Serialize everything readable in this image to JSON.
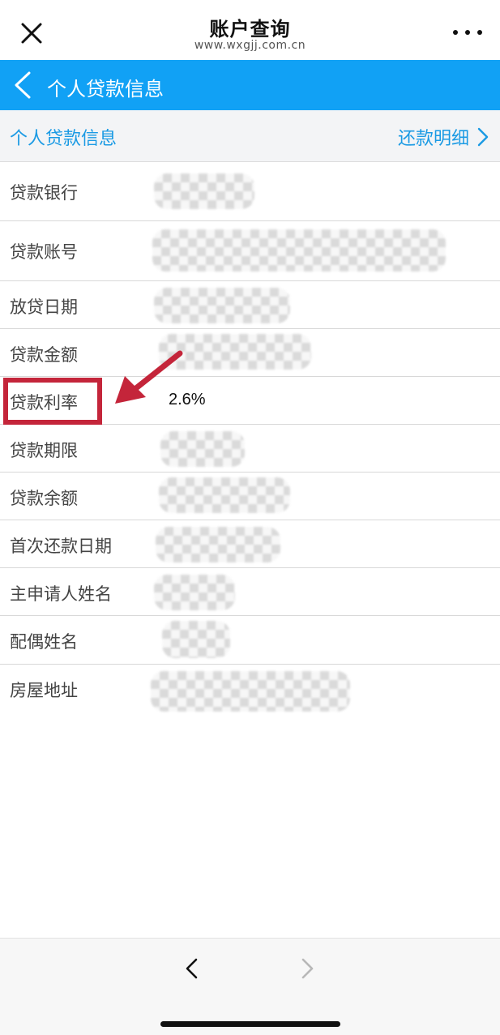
{
  "topbar": {
    "title": "账户查询",
    "url": "www.wxgjj.com.cn",
    "close_icon": "close-icon",
    "more_icon": "more-dots-icon"
  },
  "header": {
    "title": "个人贷款信息",
    "back_icon": "chevron-left-icon",
    "color": "#11a1f5"
  },
  "section": {
    "title": "个人贷款信息",
    "detail_link": "还款明细",
    "detail_icon": "chevron-right-icon",
    "accent_color": "#1a9ae4"
  },
  "rows": [
    {
      "label": "贷款银行",
      "value": ""
    },
    {
      "label": "贷款账号",
      "value": ""
    },
    {
      "label": "放贷日期",
      "value": ""
    },
    {
      "label": "贷款金额",
      "value": ""
    },
    {
      "label": "贷款利率",
      "value": "2.6%"
    },
    {
      "label": "贷款期限",
      "value": ""
    },
    {
      "label": "贷款余额",
      "value": ""
    },
    {
      "label": "首次还款日期",
      "value": ""
    },
    {
      "label": "主申请人姓名",
      "value": ""
    },
    {
      "label": "配偶姓名",
      "value": ""
    },
    {
      "label": "房屋地址",
      "value": ""
    }
  ],
  "annotation": {
    "highlight_color": "#c4253a"
  },
  "bottom_nav": {
    "back_icon": "chevron-left-icon",
    "forward_icon": "chevron-right-icon"
  }
}
